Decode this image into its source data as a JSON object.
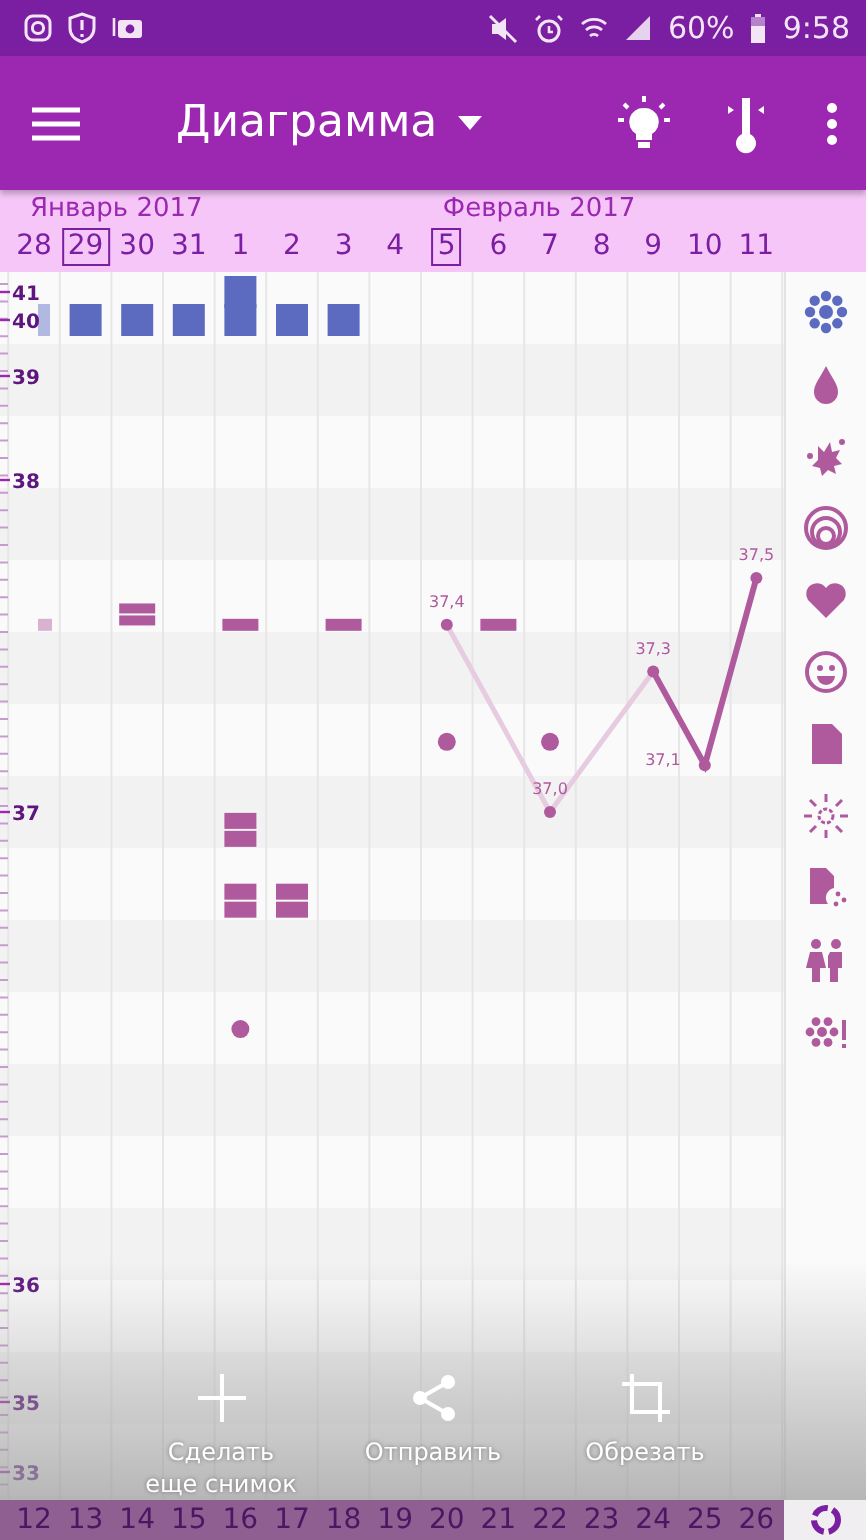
{
  "status_bar": {
    "battery": "60%",
    "time": "9:58"
  },
  "app_bar": {
    "title": "Диаграмма"
  },
  "chart": {
    "scale_labels": [
      "41",
      "40",
      "39",
      "38",
      "37",
      "36",
      "35",
      "33"
    ],
    "months": [
      "Январь 2017",
      "Февраль 2017"
    ],
    "days": [
      {
        "label": "28",
        "marked": false
      },
      {
        "label": "29",
        "marked": true
      },
      {
        "label": "30",
        "marked": false
      },
      {
        "label": "31",
        "marked": false
      },
      {
        "label": "1",
        "marked": false
      },
      {
        "label": "2",
        "marked": false
      },
      {
        "label": "3",
        "marked": false
      },
      {
        "label": "4",
        "marked": false
      },
      {
        "label": "5",
        "marked": true
      },
      {
        "label": "6",
        "marked": false
      },
      {
        "label": "7",
        "marked": false
      },
      {
        "label": "8",
        "marked": false
      },
      {
        "label": "9",
        "marked": false
      },
      {
        "label": "10",
        "marked": false
      },
      {
        "label": "11",
        "marked": false
      }
    ],
    "temperature_labels": [
      "37,4",
      "37,0",
      "37,3",
      "37,1",
      "37,5"
    ]
  },
  "share_actions": [
    {
      "kind": "add",
      "label": "Сделать еще снимок"
    },
    {
      "kind": "share",
      "label": "Отправить"
    },
    {
      "kind": "crop",
      "label": "Обрезать"
    }
  ],
  "bottom_days": [
    "12",
    "13",
    "14",
    "15",
    "16",
    "17",
    "18",
    "19",
    "20",
    "21",
    "22",
    "23",
    "24",
    "25",
    "26"
  ]
}
